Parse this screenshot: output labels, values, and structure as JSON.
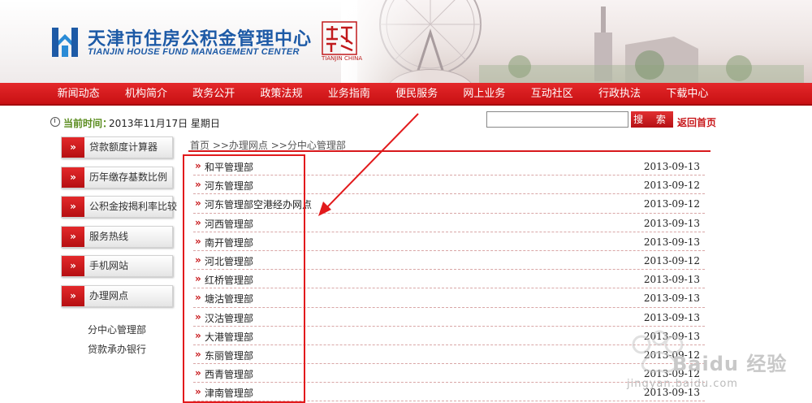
{
  "header": {
    "title_cn": "天津市住房公积金管理中心",
    "title_en": "TIANJIN HOUSE FUND MANAGEMENT CENTER",
    "seal_caption": "TIANJIN CHINA",
    "brand_color": "#1d5aa6",
    "accent_color": "#d8191c"
  },
  "nav": {
    "items": [
      "新闻动态",
      "机构简介",
      "政务公开",
      "政策法规",
      "业务指南",
      "便民服务",
      "网上业务",
      "互动社区",
      "行政执法",
      "下载中心"
    ]
  },
  "infobar": {
    "time_label": "当前时间：",
    "time_value": "2013年11月17日  星期日",
    "search_placeholder": "",
    "search_button": "搜 索",
    "home_link": "返回首页"
  },
  "sidebar": {
    "buttons": [
      "贷款额度计算器",
      "历年缴存基数比例",
      "公积金按揭利率比较",
      "服务热线",
      "手机网站",
      "办理网点"
    ],
    "sub_links": [
      "分中心管理部",
      "贷款承办银行"
    ]
  },
  "breadcrumb": "首页 >>办理网点 >>分中心管理部",
  "list": [
    {
      "name": "和平管理部",
      "date": "2013-09-13"
    },
    {
      "name": "河东管理部",
      "date": "2013-09-12"
    },
    {
      "name": "河东管理部空港经办网点",
      "date": "2013-09-12"
    },
    {
      "name": "河西管理部",
      "date": "2013-09-13"
    },
    {
      "name": "南开管理部",
      "date": "2013-09-13"
    },
    {
      "name": "河北管理部",
      "date": "2013-09-12"
    },
    {
      "name": "红桥管理部",
      "date": "2013-09-13"
    },
    {
      "name": "塘沽管理部",
      "date": "2013-09-13"
    },
    {
      "name": "汉沽管理部",
      "date": "2013-09-13"
    },
    {
      "name": "大港管理部",
      "date": "2013-09-13"
    },
    {
      "name": "东丽管理部",
      "date": "2013-09-12"
    },
    {
      "name": "西青管理部",
      "date": "2013-09-12"
    },
    {
      "name": "津南管理部",
      "date": "2013-09-13"
    }
  ],
  "icons": {
    "list_bullet": "double-chevron-right-icon",
    "side_button": "double-chevron-right-icon",
    "clock": "clock-icon"
  },
  "watermark": "Baidu 经验",
  "watermark_url": "jingyan.baidu.com"
}
